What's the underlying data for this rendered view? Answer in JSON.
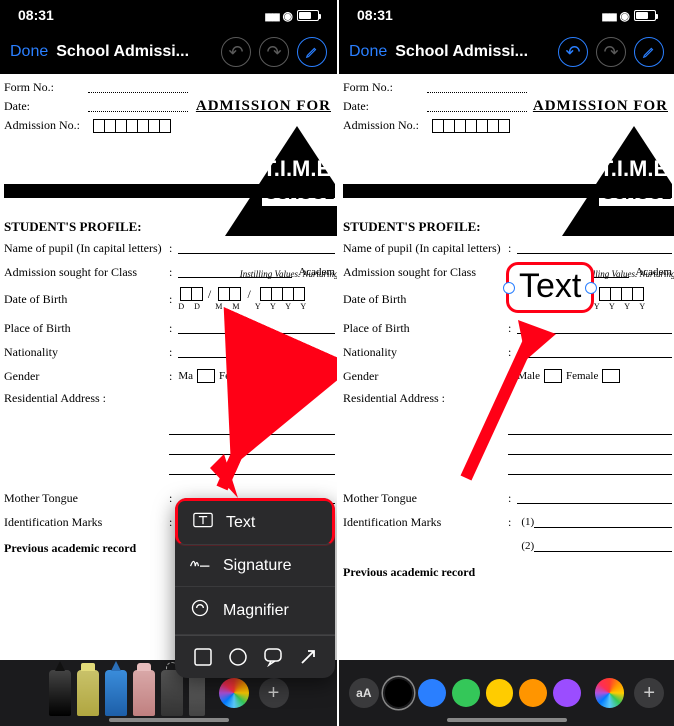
{
  "statusbar": {
    "time": "08:31"
  },
  "nav": {
    "done": "Done",
    "title": "School Admissi..."
  },
  "document": {
    "heading": "ADMISSION FOR",
    "form_no_label": "Form No.:",
    "date_label": "Date:",
    "admission_no_label": "Admission No.:",
    "logo_brand": "T.I.M.E.",
    "logo_sub": "SCHOOL",
    "logo_tag": "Instilling Values. Nurturing Exc",
    "section_profile": "STUDENT'S PROFILE:",
    "field_name": "Name of pupil (In capital letters)",
    "field_class": "Admission sought for Class",
    "class_academ": "Academ",
    "field_dob": "Date of Birth",
    "dob_d": "D   D",
    "dob_m": "M   M",
    "dob_y": "Y   Y   Y   Y",
    "field_pob": "Place of Birth",
    "field_nat": "Nationality",
    "field_gender": "Gender",
    "gender_male_left": "Ma",
    "gender_male": "Male",
    "gender_female": "Female",
    "field_addr": "Residential Address :",
    "field_tongue": "Mother Tongue",
    "field_marks": "Identification Marks",
    "marks_1": "(1)",
    "marks_2": "(2)",
    "prev_record": "Previous academic record"
  },
  "popup": {
    "text": "Text",
    "signature": "Signature",
    "magnifier": "Magnifier"
  },
  "badge": {
    "text": "Text"
  },
  "toolbar_right": {
    "aA": "aA",
    "swatches": [
      "#000000",
      "#2a7fff",
      "#34c759",
      "#ffcc00",
      "#ff9500",
      "#9b4dff"
    ]
  }
}
